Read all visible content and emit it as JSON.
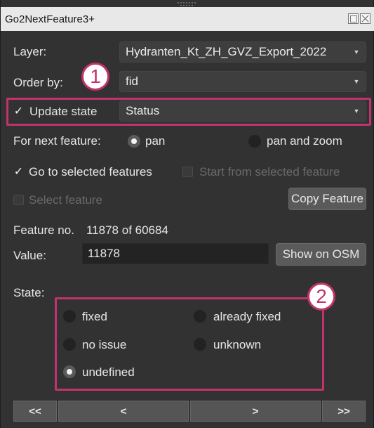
{
  "window": {
    "title": "Go2NextFeature3+"
  },
  "layer": {
    "label": "Layer:",
    "value": "Hydranten_Kt_ZH_GVZ_Export_2022"
  },
  "order_by": {
    "label": "Order by:",
    "value": "fid"
  },
  "update_state": {
    "checked": true,
    "check_glyph": "✓",
    "label": "Update state",
    "value": "Status"
  },
  "next_feature": {
    "label": "For next feature:",
    "options": [
      "pan",
      "pan and zoom"
    ],
    "selected": "pan"
  },
  "go_to_selected": {
    "checked": true,
    "check_glyph": "✓",
    "label": "Go to selected features"
  },
  "start_from_selected": {
    "checked": false,
    "enabled": false,
    "label": "Start from selected feature"
  },
  "select_feature": {
    "checked": false,
    "enabled": false,
    "label": "Select feature"
  },
  "copy_feature_button": "Copy Feature",
  "feature_no": {
    "label": "Feature no.",
    "text": "11878 of 60684"
  },
  "value": {
    "label": "Value:",
    "text": "11878"
  },
  "show_on_osm_button": "Show on OSM",
  "state": {
    "label": "State:",
    "options": [
      "fixed",
      "already fixed",
      "no issue",
      "unknown",
      "undefined"
    ],
    "selected": "undefined"
  },
  "annotations": {
    "badge1": "1",
    "badge2": "2",
    "color": "#c2336b"
  },
  "navigation": {
    "first": "<<",
    "prev": "<",
    "next": ">",
    "last": ">>"
  }
}
